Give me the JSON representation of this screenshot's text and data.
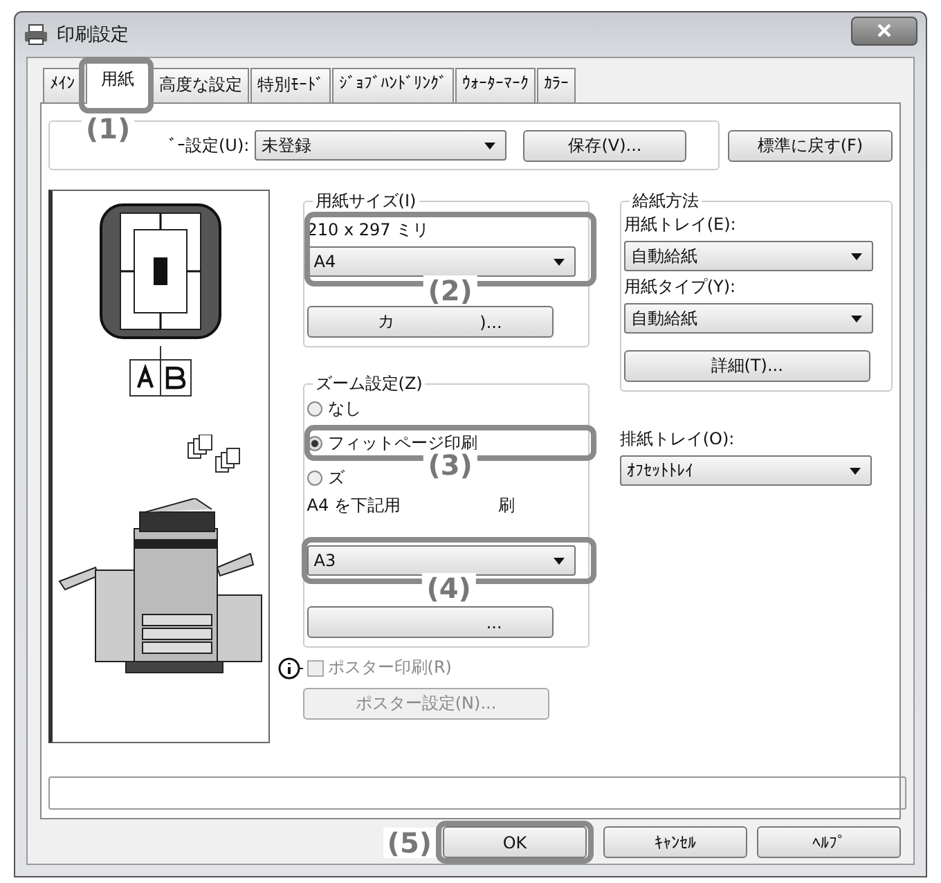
{
  "window": {
    "title": "印刷設定"
  },
  "tabs": [
    {
      "label": "ﾒｲﾝ",
      "selected": false
    },
    {
      "label": "用紙",
      "selected": true
    },
    {
      "label": "高度な設定",
      "selected": false
    },
    {
      "label": "特別ﾓｰﾄﾞ",
      "selected": false
    },
    {
      "label": "ｼﾞｮﾌﾞﾊﾝﾄﾞﾘﾝｸﾞ",
      "selected": false
    },
    {
      "label": "ｳｫｰﾀｰﾏｰｸ",
      "selected": false
    },
    {
      "label": "ｶﾗｰ",
      "selected": false
    }
  ],
  "favorites": {
    "label": "ﾞｰ設定(U):",
    "value": "未登録",
    "save_button": "保存(V)..."
  },
  "reset_button": "標準に戻す(F)",
  "paper_size": {
    "legend": "用紙サイズ(I)",
    "dimensions": "210 x 297 ミリ",
    "value": "A4",
    "button_parts": [
      "カ",
      ")..."
    ]
  },
  "zoom": {
    "legend": "ズーム設定(Z)",
    "options": [
      {
        "label": "なし",
        "selected": false
      },
      {
        "label": "フィットページ印刷",
        "selected": true
      },
      {
        "label": "ズ",
        "selected": false
      }
    ],
    "note_parts": [
      "A4 を下記用",
      "刷"
    ],
    "value": "A3",
    "button_parts": [
      "..."
    ]
  },
  "poster": {
    "label": "ポスター印刷(R)",
    "checked": false,
    "disabled": true,
    "button": "ポスター設定(N)..."
  },
  "paper_source": {
    "legend": "給紙方法",
    "tray_label": "用紙トレイ(E):",
    "tray": "自動給紙",
    "type_label": "用紙タイプ(Y):",
    "type": "自動給紙",
    "detail_button": "詳細(T)..."
  },
  "output_tray": {
    "label": "排紙トレイ(O):",
    "value": "ｵﾌｾｯﾄﾄﾚｲ"
  },
  "buttons": [
    {
      "label": "OK"
    },
    {
      "label": "ｷｬﾝｾﾙ"
    },
    {
      "label": "ﾍﾙﾌﾟ"
    }
  ],
  "callouts": [
    {
      "label": "(1)"
    },
    {
      "label": "(2)"
    },
    {
      "label": "(3)"
    },
    {
      "label": "(4)"
    },
    {
      "label": "(5)"
    }
  ]
}
